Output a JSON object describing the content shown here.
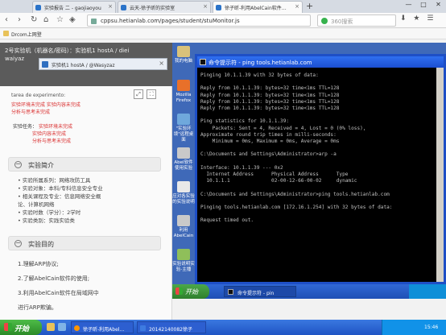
{
  "browser": {
    "tabs": [
      {
        "title": "实验报告 二 - gaojiaoyou",
        "active": false
      },
      {
        "title": "云天-徐子昕的实验室",
        "active": false
      },
      {
        "title": "徐子昕-利用AbelCain软件…",
        "active": true
      }
    ],
    "url": "cppsu.hetianlab.com/pages/student/stuMonitor.js",
    "search_placeholder": "360搜索",
    "bookmark": "Drcom上网登"
  },
  "left": {
    "breadcrumb": "2号实验机（机器名/密码）：实验机1 hostA / diei",
    "user": "waiyaz",
    "inner_tab": "实验机1   hostA / @Wasyzaz",
    "task_area_label": "tarea de experimento:",
    "task_area_lines": [
      "实验环境未完成  实验内容未完成",
      "分析与思考未完成"
    ],
    "task_label": "实验任务：",
    "task_lines": [
      "实验环境未完成",
      "实验内容未完成",
      "分析与思考未完成"
    ],
    "section_intro": "实验简介",
    "intro_items": [
      "• 实验所属系列：网络攻防工具",
      "• 实验对象：本科/专科信息安全专业",
      "• 相关课程及专业：信息网络安全概",
      "  论、计算机网络",
      "• 实验时数（学分）：2学时",
      "• 实验类别：实践实验类"
    ],
    "section_goal": "实验目的",
    "goal_items": [
      "1.理解ARP协议;",
      "2.了解AbelCain软件的使用;",
      "3.利用AbelCain软件在局域网中",
      "进行ARP欺骗。"
    ]
  },
  "vm": {
    "desktop_icons": [
      {
        "label": "我的电脑",
        "color": "#d9c27a"
      },
      {
        "label": "Mozilla Firefox",
        "color": "#e8702a"
      },
      {
        "label": "\"实验环境\"远程桌面",
        "color": "#6fa8dc"
      },
      {
        "label": "Abel软件使用实验",
        "color": "#c9c9c9"
      },
      {
        "label": "应对各实验的实验说明",
        "color": "#e8e8e8"
      },
      {
        "label": "利用AbelCain",
        "color": "#c9c9c9"
      },
      {
        "label": "实验说明实验-主播",
        "color": "#8fbf5a"
      }
    ],
    "cmd_title": "命令提示符 - ping tools.hetianlab.com",
    "cmd_text": "Pinging 10.1.1.39 with 32 bytes of data:\n\nReply from 10.1.1.39: bytes=32 time<1ms TTL=128\nReply from 10.1.1.39: bytes=32 time<1ms TTL=128\nReply from 10.1.1.39: bytes=32 time<1ms TTL=128\nReply from 10.1.1.39: bytes=32 time<1ms TTL=128\n\nPing statistics for 10.1.1.39:\n    Packets: Sent = 4, Received = 4, Lost = 0 (0% loss),\nApproximate round trip times in milli-seconds:\n    Minimum = 0ms, Maximum = 0ms, Average = 0ms\n\nC:\\Documents and Settings\\Administrator>arp -a\n\nInterface: 10.1.1.39 --- 0x2\n  Internet Address      Physical Address      Type\n  10.1.1.1              02-00-12-66-00-02     dynamic\n\nC:\\Documents and Settings\\Administrator>ping tools.hetianlab.com\n\nPinging tools.hetianlab.com [172.16.1.254] with 32 bytes of data:\n\nRequest timed out.",
    "start_label": "开始",
    "task_label": "命令提示符 - pin"
  },
  "os_taskbar": {
    "start_label": "开始",
    "tasks": [
      "徐子昕-利用Abel…",
      "20142140082徐子"
    ],
    "clock": "15:46"
  }
}
